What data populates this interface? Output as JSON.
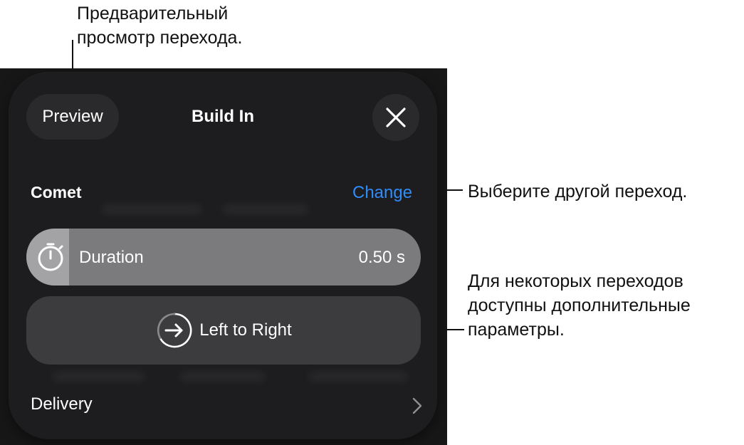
{
  "callouts": {
    "preview": [
      "Предварительный",
      "просмотр перехода."
    ],
    "change": "Выберите другой переход.",
    "options": [
      "Для некоторых переходов",
      "доступны дополнительные",
      "параметры."
    ]
  },
  "panel": {
    "preview_label": "Preview",
    "title": "Build In",
    "close_icon": "close-icon"
  },
  "effect": {
    "name": "Comet",
    "change_label": "Change"
  },
  "duration": {
    "icon": "stopwatch-icon",
    "label": "Duration",
    "value": "0.50 s"
  },
  "direction": {
    "icon": "arrow-right-circle-icon",
    "label": "Left to Right"
  },
  "delivery": {
    "label": "Delivery",
    "icon": "chevron-right-icon"
  },
  "colors": {
    "accent": "#2f8cf8",
    "panel_bg": "#1d1d1f",
    "duration_bg": "#7b7b7d",
    "direction_bg": "#3c3c3e"
  }
}
